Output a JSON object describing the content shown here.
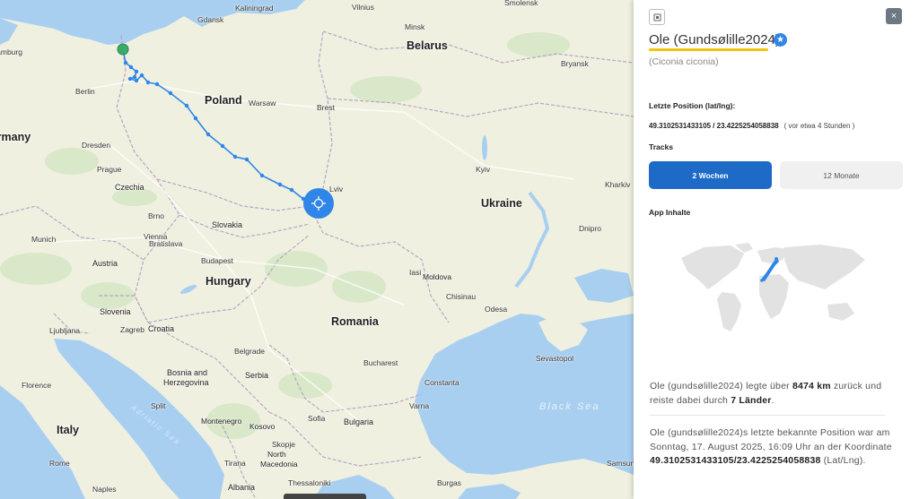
{
  "map": {
    "countries": [
      "Belarus",
      "Poland",
      "Czechia",
      "Ukraine",
      "Slovakia",
      "Hungary",
      "Austria",
      "Moldova",
      "Slovenia",
      "Croatia",
      "Romania",
      "Bosnia and",
      "Herzegovina",
      "Serbia",
      "Bulgaria",
      "Italy",
      "Montenegro",
      "Kosovo",
      "North",
      "Macedonia",
      "Albania",
      "Germany"
    ],
    "cities": [
      "Gdansk",
      "Kaliningrad",
      "Vilnius",
      "Smolensk",
      "Minsk",
      "Bryansk",
      "Hamburg",
      "Berlin",
      "Warsaw",
      "Brest",
      "Dresden",
      "Prague",
      "Kyiv",
      "Kharkiv",
      "Lviv",
      "Brno",
      "Munich",
      "Vienna",
      "Bratislava",
      "Budapest",
      "Dnipro",
      "Iasi",
      "Chisinau",
      "Odesa",
      "Zagreb",
      "Ljubljana",
      "Florence",
      "Belgrade",
      "Bucharest",
      "Sevastopol",
      "Constanta",
      "Sofia",
      "Varna",
      "Split",
      "Skopje",
      "Tirana",
      "Thessaloniki",
      "Naples",
      "Burgas",
      "Rome",
      "Samsun"
    ],
    "seas": [
      "Black Sea",
      "Adriatic Sea"
    ],
    "colors": {
      "land": "#f0f0e0",
      "water": "#a9cff0",
      "track": "#2f86e8",
      "start": "#3cab6a"
    }
  },
  "panel": {
    "copy_icon": "copy-icon",
    "close_label": "×",
    "name": "Ole (Gundsølille2024)",
    "verified_icon": "star-badge-icon",
    "species": "(Ciconia ciconia)",
    "position_label": "Letzte Position (lat/lng):",
    "coords": "49.3102531433105 / 23.4225254058838",
    "since": "( vor etwa 4 Stunden )",
    "tracks_label": "Tracks",
    "tab_2w": "2 Wochen",
    "tab_12m": "12 Monate",
    "app_label": "App Inhalte",
    "summary": {
      "pre": "Ole (gundsølille2024) legte über ",
      "distance": "8474 km",
      "mid": " zurück und reiste dabei durch ",
      "countries": "7 Länder",
      "post": "."
    },
    "last": {
      "pre": "Ole (gundsølille2024)s letzte bekannte Position war am Sonntag, 17. August 2025, 16:09 Uhr an der Koordinate ",
      "coord": "49.3102531433105/23.4225254058838",
      "post": " (Lat/Lng)."
    }
  }
}
